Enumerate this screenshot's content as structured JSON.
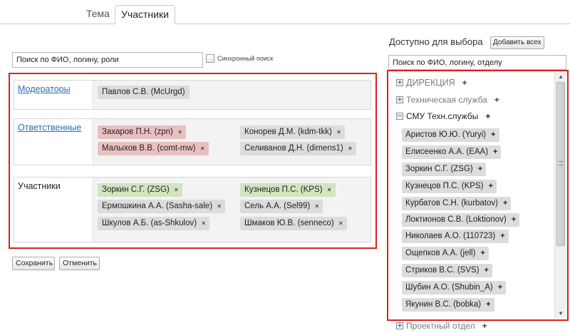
{
  "tabs": [
    {
      "label": "Тема"
    },
    {
      "label": "Участники"
    }
  ],
  "left": {
    "search_value": "Поиск по ФИО, логину, роли",
    "sync_label": "Синхронный поиск",
    "roles": {
      "moderators": {
        "title": "Модераторы",
        "people": [
          "Павлов С.В. (McUrgd)"
        ]
      },
      "responsible": {
        "title": "Ответственные",
        "people": [
          "Захаров П.Н. (zpn)",
          "Конорев Д.М. (kdm-tkk)",
          "Малыхов В.В. (comt-mw)",
          "Селиванов Д.Н. (dimens1)"
        ]
      },
      "participants": {
        "title": "Участники",
        "people": [
          "Зоркин С.Г. (ZSG)",
          "Кузнецов П.С. (KPS)",
          "Ермошкина А.А. (Sasha-sale)",
          "Сель А.А. (Sel99)",
          "Шкулов А.Б. (as-Shkulov)",
          "Шмаков Ю.В. (senneco)"
        ]
      }
    },
    "remove_symbol": "×",
    "save_label": "Сохранить",
    "cancel_label": "Отменить"
  },
  "right": {
    "title": "Доступно для выбора",
    "add_all_label": "Добавить всех",
    "search_value": "Поиск по ФИО, логину, отделу",
    "groups": [
      "ДИРЕКЦИЯ",
      "Техническая служба",
      "СМУ Техн.службы",
      "Проектный отдел"
    ],
    "expander_plus": "+",
    "expander_minus": "−",
    "add_symbol": "+",
    "available": [
      "Аристов Ю.Ю. (Yuryi)",
      "Елисеенко А.А. (EAA)",
      "Зоркин С.Г. (ZSG)",
      "Кузнецов П.С. (KPS)",
      "Курбатов С.Н. (kurbatov)",
      "Локтионов С.В. (Loktionov)",
      "Николаев А.О. (110723)",
      "Ощепков А.А. (jell)",
      "Стриков В.С. (SVS)",
      "Шубин А.О. (Shubin_A)",
      "Якунин В.С. (bobka)"
    ]
  }
}
